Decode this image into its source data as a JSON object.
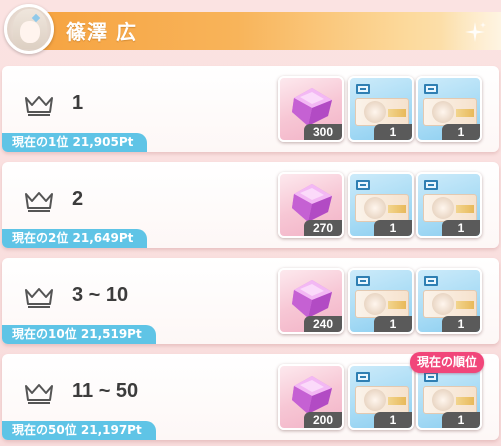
{
  "header": {
    "name": "篠澤 広"
  },
  "rows": [
    {
      "rank": "1",
      "score_label": "現在の1位  21,905Pt",
      "rewards": [
        {
          "type": "gem-icon",
          "count": "300"
        },
        {
          "type": "ticket-icon",
          "count": "1"
        },
        {
          "type": "ticket-icon",
          "count": "1"
        }
      ]
    },
    {
      "rank": "2",
      "score_label": "現在の2位  21,649Pt",
      "rewards": [
        {
          "type": "gem-icon",
          "count": "270"
        },
        {
          "type": "ticket-icon",
          "count": "1"
        },
        {
          "type": "ticket-icon",
          "count": "1"
        }
      ]
    },
    {
      "rank": "3 ~ 10",
      "score_label": "現在の10位  21,519Pt",
      "rewards": [
        {
          "type": "gem-icon",
          "count": "240"
        },
        {
          "type": "ticket-icon",
          "count": "1"
        },
        {
          "type": "ticket-icon",
          "count": "1"
        }
      ]
    },
    {
      "rank": "11 ~ 50",
      "score_label": "現在の50位  21,197Pt",
      "rewards": [
        {
          "type": "gem-icon",
          "count": "200"
        },
        {
          "type": "ticket-icon",
          "count": "1"
        },
        {
          "type": "ticket-icon",
          "count": "1"
        }
      ]
    }
  ],
  "current_rank_badge": "現在の順位",
  "colors": {
    "header_orange": "#f6a23f",
    "score_pill_blue": "#5fc4e6",
    "current_badge_pink": "#f1467a",
    "count_badge_gray": "#5a5a5a"
  }
}
